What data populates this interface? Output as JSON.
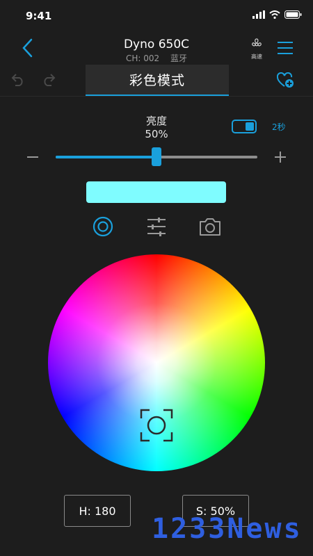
{
  "status_bar": {
    "time": "9:41"
  },
  "header": {
    "device_name": "Dyno 650C",
    "channel": "CH: 002",
    "connection": "蓝牙",
    "fan_label": "高速"
  },
  "toolbar": {
    "mode_title": "彩色模式"
  },
  "brightness": {
    "label": "亮度",
    "value_text": "50%",
    "level": 0.5,
    "fade_time": "2秒"
  },
  "color": {
    "preview_hex": "#7ffcff",
    "hue_text": "H: 180",
    "saturation_text": "S: 50%"
  },
  "watermark": "1233News",
  "colors": {
    "accent": "#1aa0dc",
    "background": "#1d1d1d"
  }
}
